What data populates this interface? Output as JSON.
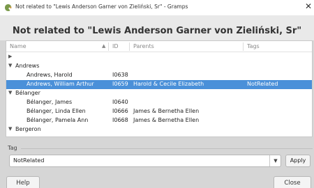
{
  "window": {
    "title": "Not related to \"Lewis Anderson Garner von Zieliński, Sr\" - Gramps",
    "app_icon": "gramps-icon",
    "close_glyph": "✕"
  },
  "heading": "Not related to \"Lewis Anderson Garner von Zieliński, Sr\"",
  "tree": {
    "columns": [
      "Name",
      "ID",
      "Parents",
      "Tags"
    ],
    "sort_indicator": "▲",
    "rows": [
      {
        "type": "group",
        "expanded": false,
        "name": "",
        "id": "",
        "parents": "",
        "tags": ""
      },
      {
        "type": "group",
        "expanded": true,
        "name": "Andrews",
        "id": "",
        "parents": "",
        "tags": ""
      },
      {
        "type": "person",
        "name": "Andrews, Harold",
        "id": "I0638",
        "parents": "",
        "tags": ""
      },
      {
        "type": "person",
        "name": "Andrews, William Arthur",
        "id": "I0659",
        "parents": "Harold & Cecile Elizabeth",
        "tags": "NotRelated",
        "selected": true
      },
      {
        "type": "group",
        "expanded": true,
        "name": "Bélanger",
        "id": "",
        "parents": "",
        "tags": ""
      },
      {
        "type": "person",
        "name": "Bélanger, James",
        "id": "I0640",
        "parents": "",
        "tags": ""
      },
      {
        "type": "person",
        "name": "Bélanger, Linda Ellen",
        "id": "I0666",
        "parents": "James & Bernetha Ellen",
        "tags": ""
      },
      {
        "type": "person",
        "name": "Bélanger, Pamela Ann",
        "id": "I0668",
        "parents": "James & Bernetha Ellen",
        "tags": ""
      },
      {
        "type": "group",
        "expanded": true,
        "name": "Bergeron",
        "id": "",
        "parents": "",
        "tags": ""
      }
    ]
  },
  "tag": {
    "legend": "Tag",
    "selected_value": "NotRelated",
    "apply_label": "Apply"
  },
  "footer": {
    "help_label": "Help",
    "close_label": "Close"
  },
  "colors": {
    "selection": "#4a90d9",
    "background": "#d6d6d6"
  }
}
